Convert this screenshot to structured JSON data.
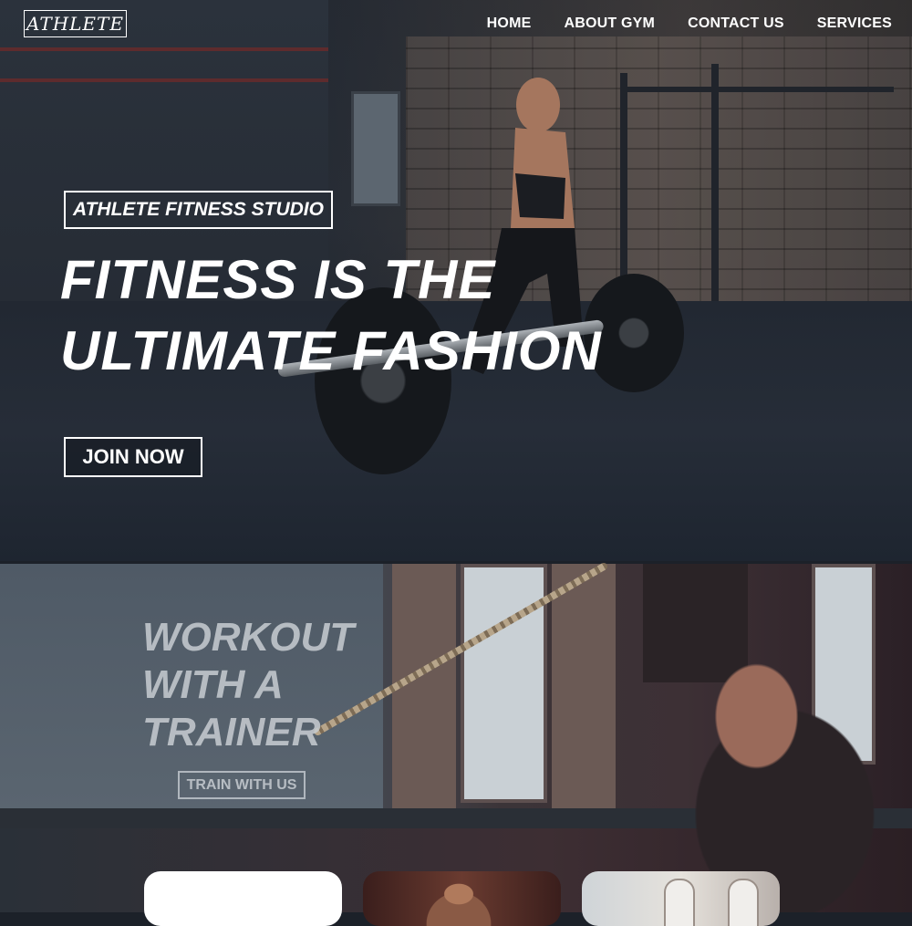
{
  "nav": {
    "logo": "ATHLETE",
    "links": [
      "HOME",
      "ABOUT GYM",
      "CONTACT US",
      "SERVICES"
    ]
  },
  "hero": {
    "tagline": "ATHLETE FITNESS STUDIO",
    "headline_line1": "FITNESS IS THE",
    "headline_line2": "ULTIMATE FASHION",
    "cta": "JOIN NOW"
  },
  "trainer": {
    "title_line1": "WORKOUT",
    "title_line2": "WITH A",
    "title_line3": "TRAINER",
    "cta": "TRAIN WITH US"
  },
  "colors": {
    "text": "#ffffff",
    "hero_bg": "#262c35",
    "muted_text": "#c8cdd2"
  }
}
